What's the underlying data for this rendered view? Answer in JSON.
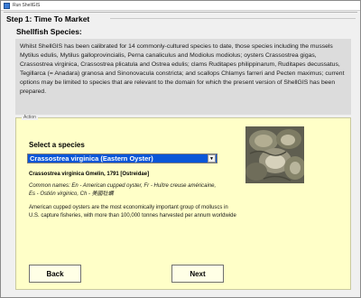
{
  "window": {
    "title": "Run ShellGIS"
  },
  "step": {
    "title": "Step 1: Time To Market"
  },
  "species_section": {
    "heading": "Shellfish Species:",
    "description": "Whilst ShellGIS has been calibrated for 14 commonly-cultured species to date, those species including the mussels Mytilus edulis, Mytilus galloprovincialis, Perna canaliculus  and Modiolus modiolus; oysters Crassostrea gigas, Crassostrea virginica, Crassostrea plicatula and Ostrea edulis; clams Ruditapes philippinarum, Ruditapes decussatus, Tegillarca (= Anadara) granosa and Sinonovacula constricta; and scallops Chlamys farreri and Pecten maximus; current options may be limited to species that are relevant to the domain for which the present version of ShellGIS has been prepared."
  },
  "action": {
    "legend": "Action",
    "select_label": "Select a species",
    "selected_species": "Crassostrea virginica (Eastern Oyster)",
    "scientific_name": "Crassostrea virginica Gmelin, 1791 [Ostreidae]",
    "common_names": "Common names: En - American cupped oyster, Fr - Huître creuse américaine, Es - Ostión virginico, Ch - 美國牡蠣",
    "info": "American cupped oysters are the most economically important group of molluscs in U.S. capture fisheries, with more than 100,000 tonnes harvested per annum worldwide",
    "back_label": "Back",
    "next_label": "Next"
  },
  "colors": {
    "selection_blue": "#0a56d8",
    "action_panel": "#ffffc8",
    "description_panel": "#dcdcdc"
  },
  "icons": {
    "app_icon": "app-icon",
    "dropdown": "chevron-down-icon",
    "photo": "oyster-photo"
  }
}
